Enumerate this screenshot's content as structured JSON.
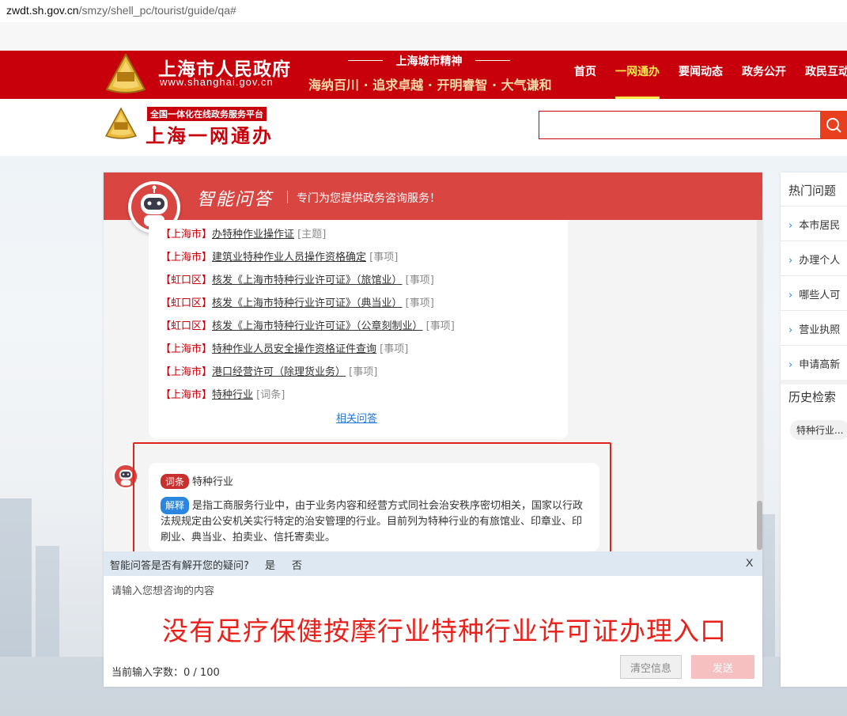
{
  "browser": {
    "url_host": "zwdt.sh.gov.cn",
    "url_path": "/smzy/shell_pc/tourist/guide/qa#"
  },
  "header": {
    "gov_title": "上海市人民政府",
    "gov_url": "www.shanghai.gov.cn",
    "spirit_title": "上海城市精神",
    "spirit_sub": "海纳百川 · 追求卓越 · 开明睿智 · 大气谦和",
    "nav": [
      "首页",
      "一网通办",
      "要闻动态",
      "政务公开",
      "政民互动"
    ],
    "nav_active": "一网通办"
  },
  "subheader": {
    "platform_tag": "全国一体化在线政务服务平台",
    "brand": "上海一网通办",
    "search_value": ""
  },
  "chat": {
    "title": "智能问答",
    "subtitle": "专门为您提供政务咨询服务！",
    "results": [
      {
        "region": "【上海市】",
        "title": "办特种作业操作证",
        "type": "[主题]"
      },
      {
        "region": "【上海市】",
        "title": "建筑业特种作业人员操作资格确定",
        "type": "[事项]"
      },
      {
        "region": "【虹口区】",
        "title": "核发《上海市特种行业许可证》（旅馆业）",
        "type": "[事项]"
      },
      {
        "region": "【虹口区】",
        "title": "核发《上海市特种行业许可证》（典当业）",
        "type": "[事项]"
      },
      {
        "region": "【虹口区】",
        "title": "核发《上海市特种行业许可证》（公章刻制业）",
        "type": "[事项]"
      },
      {
        "region": "【上海市】",
        "title": "特种作业人员安全操作资格证件查询",
        "type": "[事项]"
      },
      {
        "region": "【上海市】",
        "title": "港口经营许可（除理货业务）",
        "type": "[事项]"
      },
      {
        "region": "【上海市】",
        "title": "特种行业",
        "type": "[词条]"
      }
    ],
    "related_link": "相关问答",
    "answer": {
      "term_tag": "词条",
      "term": "特种行业",
      "explain_tag": "解释",
      "explain": "是指工商服务行业中，由于业务内容和经营方式同社会治安秩序密切相关，国家以行政法规规定由公安机关实行特定的治安管理的行业。目前列为特种行业的有旅馆业、印章业、印刷业、典当业、拍卖业、信托寄卖业。"
    },
    "feedback": {
      "question": "智能问答是否有解开您的疑问?",
      "yes": "是",
      "no": "否",
      "close": "X"
    },
    "input": {
      "placeholder": "请输入您想咨询的内容",
      "overlay": "没有足疗保健按摩行业特种行业许可证办理入口",
      "count_label": "当前输入字数：",
      "count": "0 / 100",
      "clear": "清空信息",
      "send": "发送"
    }
  },
  "sidebar": {
    "hot_title": "热门问题",
    "hot_items": [
      "本市居民",
      "办理个人",
      "哪些人可",
      "营业执照",
      "申请高新"
    ],
    "history_title": "历史检索",
    "history_items": [
      "特种行业..."
    ]
  },
  "colors": {
    "gov_red": "#c7000b",
    "chat_red": "#d94540",
    "link_blue": "#2277dd",
    "nav_active": "#ffe94d"
  }
}
